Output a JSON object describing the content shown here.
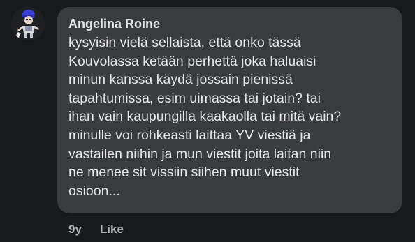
{
  "comment": {
    "avatar_icon": "profile-picture-icon",
    "author": "Angelina Roine",
    "text": "kysyisin vielä sellaista, että onko tässä\nKouvolassa ketään perhettä joka haluaisi\nminun kanssa käydä jossain pienissä\ntapahtumissa, esim uimassa tai jotain? tai\nihan vain kaupungilla kaakaolla tai mitä vain?\nminulle voi rohkeasti laittaa YV viestiä ja\nvastailen niihin ja mun viestit joita laitan niin\nne menee sit vissiin siihen muut viestit\nosioon...",
    "timestamp": "9y",
    "like_label": "Like"
  },
  "colors": {
    "page_background": "#18191a",
    "bubble_background": "#3a3b3c",
    "primary_text": "#e4e6eb",
    "secondary_text": "#b0b3b8"
  }
}
